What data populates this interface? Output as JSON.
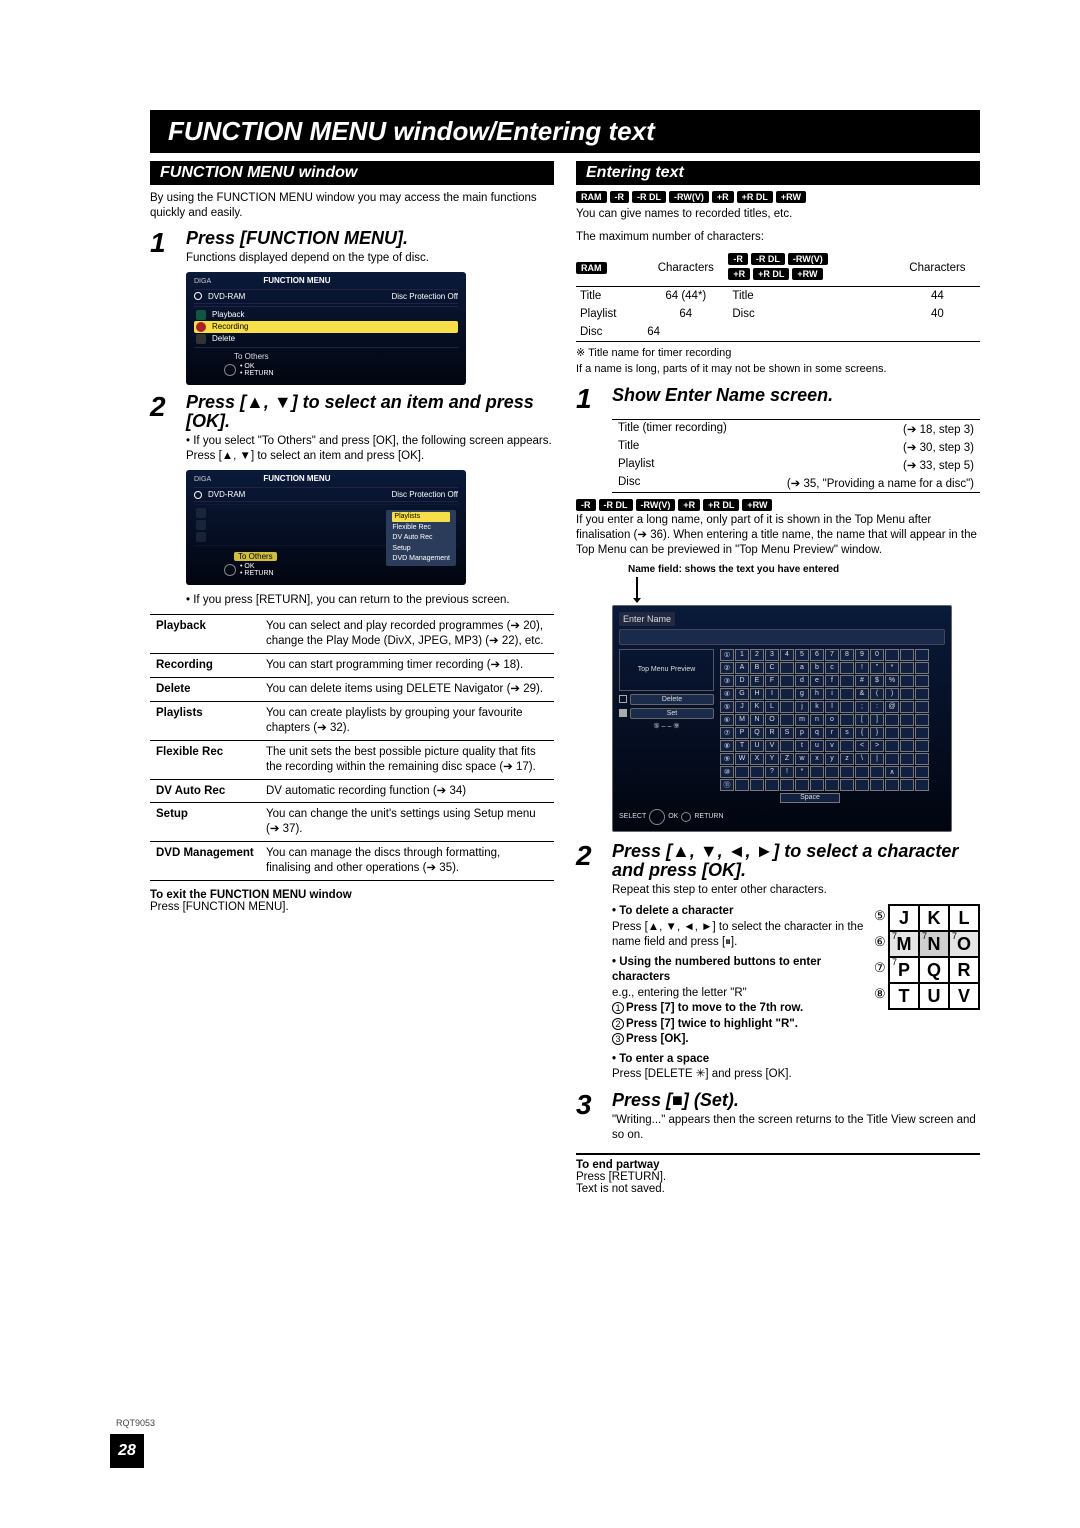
{
  "page": {
    "main_title": "FUNCTION MENU window/Entering text",
    "footer_code": "RQT9053",
    "footer_page": "28"
  },
  "left": {
    "header": "FUNCTION MENU window",
    "intro": "By using the FUNCTION MENU window you may access the main functions quickly and easily.",
    "step1": {
      "num": "1",
      "title": "Press [FUNCTION MENU].",
      "sub": "Functions displayed depend on the type of disc."
    },
    "shot1": {
      "brand": "DIGA",
      "fm": "FUNCTION MENU",
      "disc_type": "DVD-RAM",
      "protection": "Disc Protection  Off",
      "items": [
        "Playback",
        "Recording",
        "Delete"
      ],
      "to_others": "To Others",
      "ok": "OK",
      "return": "RETURN"
    },
    "step2": {
      "num": "2",
      "title": "Press [▲, ▼] to select an item and press [OK].",
      "bullet": "If you select \"To Others\" and press [OK], the following screen appears. Press [▲, ▼] to select an item and press [OK]."
    },
    "shot2": {
      "submenu": [
        "Playlists",
        "Flexible Rec",
        "DV Auto Rec",
        "Setup",
        "DVD Management"
      ]
    },
    "return_note": "If you press [RETURN], you can return to the previous screen.",
    "table": [
      {
        "k": "Playback",
        "v": "You can select and play recorded programmes (➔ 20), change the Play Mode (DivX, JPEG, MP3) (➔ 22), etc."
      },
      {
        "k": "Recording",
        "v": "You can start programming timer recording (➔ 18)."
      },
      {
        "k": "Delete",
        "v": "You can delete items using DELETE Navigator (➔ 29)."
      },
      {
        "k": "Playlists",
        "v": "You can create playlists by grouping your favourite chapters (➔ 32)."
      },
      {
        "k": "Flexible Rec",
        "v": "The unit sets the best possible picture quality that fits the recording within the remaining disc space (➔ 17)."
      },
      {
        "k": "DV Auto Rec",
        "v": "DV automatic recording function (➔ 34)"
      },
      {
        "k": "Setup",
        "v": "You can change the unit's settings using Setup menu (➔ 37)."
      },
      {
        "k": "DVD Management",
        "v": "You can manage the discs through formatting, finalising and other operations (➔ 35)."
      }
    ],
    "exit_bold": "To exit the FUNCTION MENU window",
    "exit_text": "Press [FUNCTION MENU]."
  },
  "right": {
    "header": "Entering text",
    "formats_top": [
      "RAM",
      "-R",
      "-R DL",
      "-RW(V)",
      "+R",
      "+R DL",
      "+RW"
    ],
    "intro1": "You can give names to recorded titles, etc.",
    "intro2": "The maximum number of characters:",
    "char_table": {
      "left_head": "RAM",
      "left_col": "Characters",
      "right_head_fmts": [
        "-R",
        "-R DL",
        "-RW(V)",
        "+R",
        "+R DL",
        "+RW"
      ],
      "right_col": "Characters",
      "rows_left": [
        {
          "label": "Title",
          "val": "64 (44*)"
        },
        {
          "label": "Playlist",
          "val": "64"
        },
        {
          "label": "Disc",
          "val": "64"
        }
      ],
      "rows_right": [
        {
          "label": "Title",
          "val": "44"
        },
        {
          "label": "Disc",
          "val": "40"
        }
      ]
    },
    "note_star": "※ Title name for timer recording",
    "note_long": "If a name is long, parts of it may not be shown in some screens.",
    "step1": {
      "num": "1",
      "title": "Show Enter Name screen.",
      "rows": [
        {
          "l": "Title (timer recording)",
          "r": "(➔ 18, step 3)"
        },
        {
          "l": "Title",
          "r": "(➔ 30, step 3)"
        },
        {
          "l": "Playlist",
          "r": "(➔ 33, step 5)"
        },
        {
          "l": "Disc",
          "r": "(➔ 35, \"Providing a name for a disc\")"
        }
      ]
    },
    "formats_mid": [
      "-R",
      "-R DL",
      "-RW(V)",
      "+R",
      "+R DL",
      "+RW"
    ],
    "tip_long": "If you enter a long name, only part of it is shown in the Top Menu after finalisation (➔ 36). When entering a title name, the name that will appear in the Top Menu can be previewed in \"Top Menu Preview\" window.",
    "name_field": "Name field: shows the text you have entered",
    "enter_shot": {
      "title": "Enter Name",
      "top_menu": "Top Menu Preview",
      "delete": "Delete",
      "set": "Set",
      "range": "⑤ – – ⑨",
      "select": "SELECT",
      "ok": "OK",
      "return": "RETURN",
      "space": "Space"
    },
    "step2": {
      "num": "2",
      "title": "Press [▲, ▼, ◄, ►] to select a character and press [OK].",
      "sub": "Repeat this step to enter other characters.",
      "del_h": "To delete a character",
      "del_t": "Press [▲, ▼, ◄, ►] to select the character in the name field and press [⏸].",
      "numbtn_h": "Using the numbered buttons to enter characters",
      "eg": "e.g., entering the letter \"R\"",
      "l1": "Press [7] to move to the 7th row.",
      "l2": "Press [7] twice to highlight \"R\".",
      "l3": "Press [OK].",
      "space_h": "To enter a space",
      "space_t": "Press [DELETE ✳] and press [OK]."
    },
    "keypad": {
      "cells": [
        [
          "J",
          "K",
          "L"
        ],
        [
          "M",
          "N",
          "O"
        ],
        [
          "P",
          "Q",
          "R"
        ],
        [
          "T",
          "U",
          "V"
        ]
      ],
      "side": [
        "⑤",
        "⑥",
        "⑦",
        "⑧"
      ],
      "inner": [
        "7",
        "7",
        "7"
      ]
    },
    "step3": {
      "num": "3",
      "title": "Press [■] (Set).",
      "sub": "\"Writing...\" appears then the screen returns to the Title View screen and so on."
    },
    "end": {
      "h": "To end partway",
      "t1": "Press [RETURN].",
      "t2": "Text is not saved."
    }
  }
}
